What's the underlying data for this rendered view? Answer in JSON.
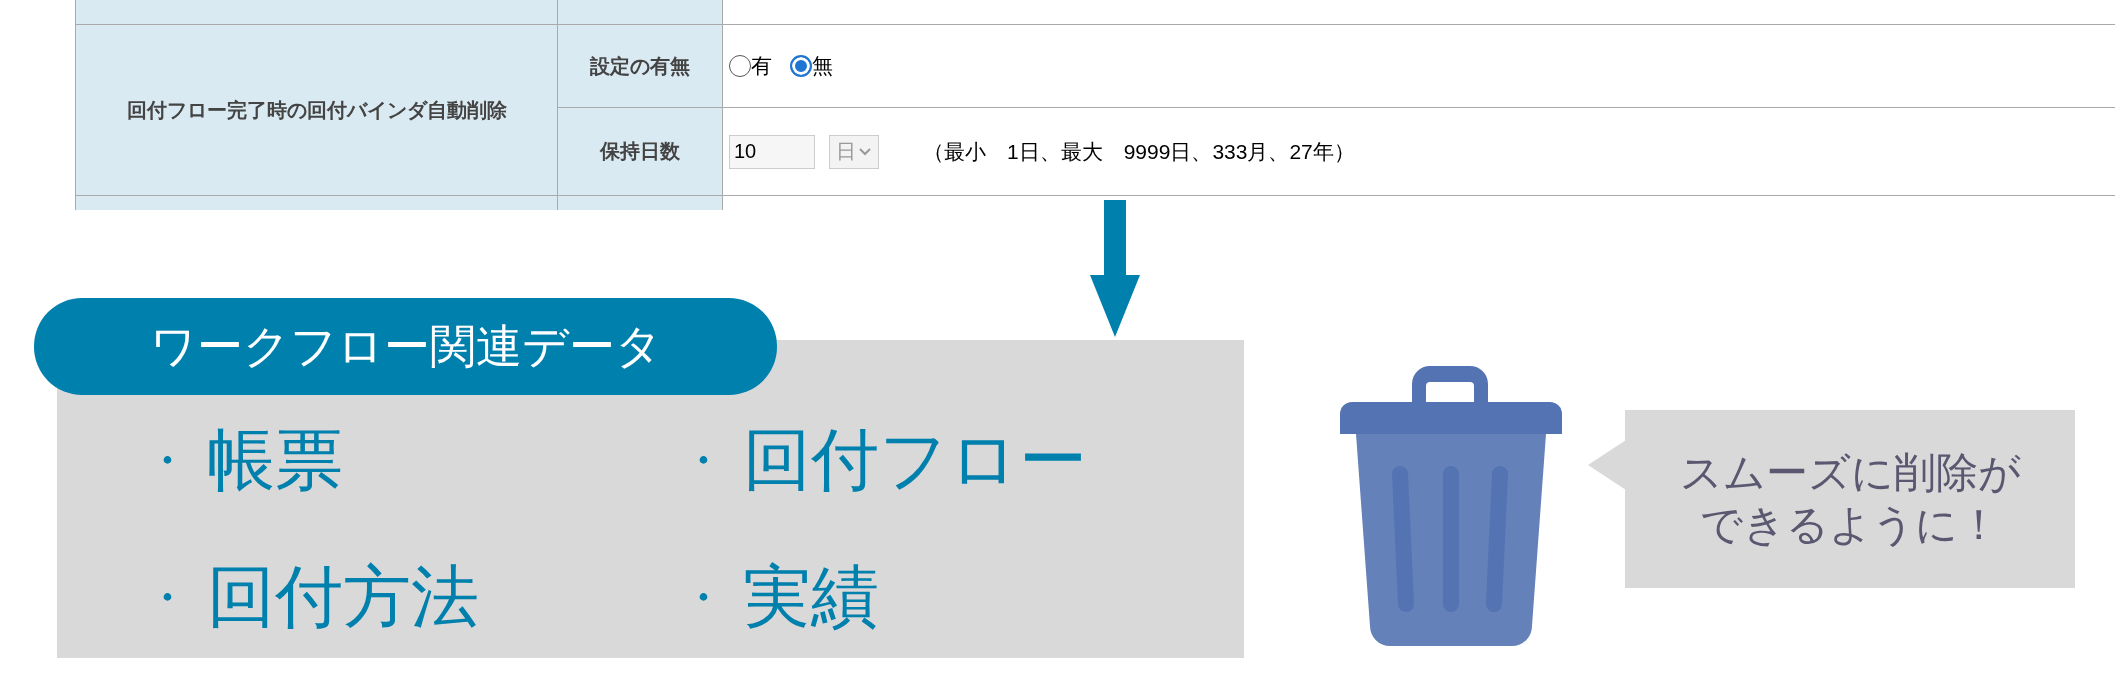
{
  "settings_table": {
    "row_label": "回付フロー完了時の回付バインダ自動削除",
    "fields": [
      {
        "kind": "radio",
        "label": "設定の有無",
        "options": [
          {
            "label": "有",
            "selected": false
          },
          {
            "label": "無",
            "selected": true
          }
        ]
      },
      {
        "kind": "number",
        "label": "保持日数",
        "value": "10",
        "unit": "日",
        "note": "（最小　1日、最大　9999日、333月、27年）"
      }
    ]
  },
  "data_box": {
    "title": "ワークフロー関連データ",
    "bullet": "・",
    "items": [
      "帳票",
      "回付フロー",
      "回付方法",
      "実績"
    ]
  },
  "callout": {
    "lines": [
      "スムーズに削除が",
      "できるように！"
    ]
  }
}
